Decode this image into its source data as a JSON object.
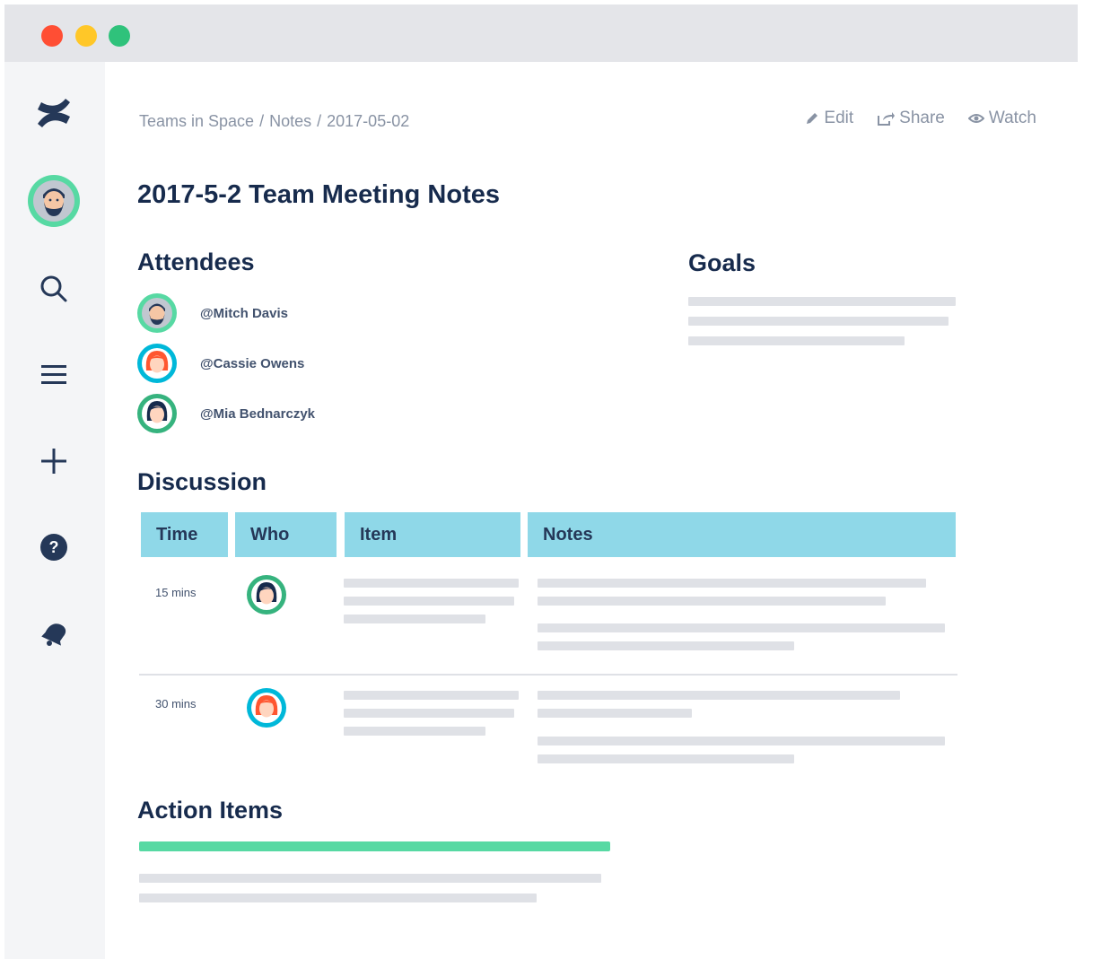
{
  "window": {
    "traffic_lights": [
      "close",
      "minimize",
      "maximize"
    ],
    "colors": {
      "close": "#ff4e34",
      "minimize": "#ffc728",
      "maximize": "#2fc27b"
    }
  },
  "sidebar": {
    "items": [
      {
        "icon": "confluence-logo-icon"
      },
      {
        "icon": "user-avatar-icon"
      },
      {
        "icon": "search-icon"
      },
      {
        "icon": "menu-icon"
      },
      {
        "icon": "plus-icon"
      },
      {
        "icon": "help-icon"
      },
      {
        "icon": "notification-icon"
      }
    ]
  },
  "breadcrumb": {
    "items": [
      "Teams in Space",
      "Notes",
      "2017-05-02"
    ],
    "separator": "/"
  },
  "actions": {
    "edit": "Edit",
    "share": "Share",
    "watch": "Watch"
  },
  "page": {
    "title": "2017-5-2 Team Meeting Notes"
  },
  "attendees": {
    "heading": "Attendees",
    "list": [
      {
        "name": "@Mitch Davis",
        "avatar": "bearded-man-avatar-icon"
      },
      {
        "name": "@Cassie Owens",
        "avatar": "red-hair-woman-avatar-icon"
      },
      {
        "name": "@Mia Bednarczyk",
        "avatar": "dark-hair-woman-avatar-icon"
      }
    ]
  },
  "goals": {
    "heading": "Goals"
  },
  "discussion": {
    "heading": "Discussion",
    "columns": [
      "Time",
      "Who",
      "Item",
      "Notes"
    ],
    "rows": [
      {
        "time": "15 mins",
        "who_avatar": "dark-hair-woman-avatar-icon"
      },
      {
        "time": "30 mins",
        "who_avatar": "red-hair-woman-avatar-icon"
      }
    ],
    "header_color": "#8fd8e8"
  },
  "action_items": {
    "heading": "Action Items",
    "accent_color": "#57d9a3"
  }
}
